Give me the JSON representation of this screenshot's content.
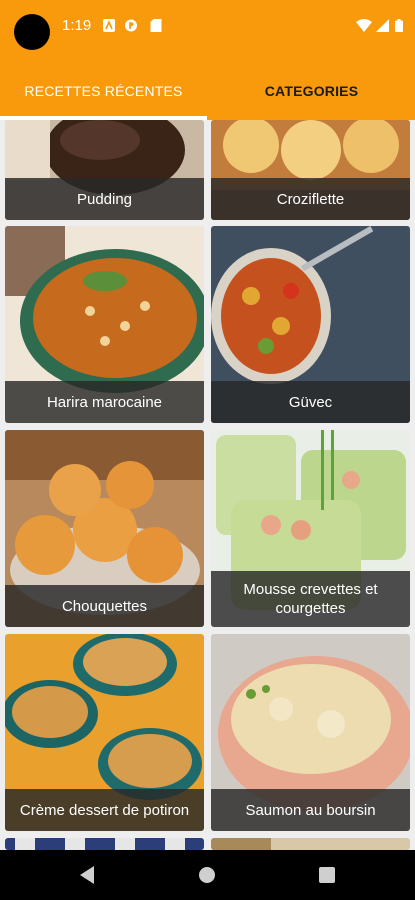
{
  "status_bar": {
    "time": "1:19"
  },
  "tabs": [
    {
      "label": "RECETTES RÉCENTES",
      "selected": true
    },
    {
      "label": "CATEGORIES",
      "selected": false
    }
  ],
  "recipes": [
    {
      "title": "Pudding"
    },
    {
      "title": "Croziflette"
    },
    {
      "title": "Harira marocaine"
    },
    {
      "title": "Güvec"
    },
    {
      "title": "Chouquettes"
    },
    {
      "title": "Mousse crevettes et courgettes"
    },
    {
      "title": "Crème dessert de potiron"
    },
    {
      "title": "Saumon au boursin"
    }
  ],
  "colors": {
    "accent": "#f99a0c",
    "tab_indicator": "#ffffff",
    "caption_bg": "#282828"
  }
}
